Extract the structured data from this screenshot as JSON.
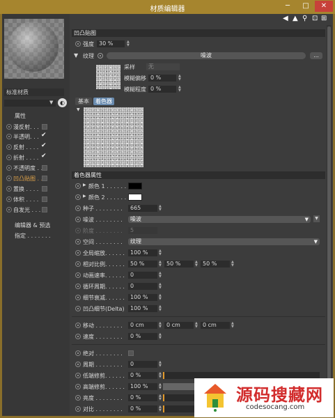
{
  "window": {
    "title": "材质编辑器",
    "min": "─",
    "max": "□",
    "close": "✕"
  },
  "left": {
    "material_name": "标准材质",
    "channels_header": "属性",
    "channels": [
      {
        "label": "漫反射. . .",
        "checked": false
      },
      {
        "label": "半透明. . .",
        "checked": true
      },
      {
        "label": "反射 . . . .",
        "checked": true
      },
      {
        "label": "折射 . . . .",
        "checked": true
      },
      {
        "label": "不透明度 . .",
        "checked": false
      },
      {
        "label": "凹凸贴图 . .",
        "checked": false,
        "active": true
      },
      {
        "label": "置换 . . . .",
        "checked": false
      },
      {
        "label": "体积 . . . .",
        "checked": false
      },
      {
        "label": "自发光 . . .",
        "checked": false
      }
    ],
    "editor_link": "编辑器 & 预选",
    "assign_link": "指定 . . . . . . ."
  },
  "right": {
    "section_bump": "凹凸贴图",
    "strength": {
      "label": "强度",
      "value": "30 %"
    },
    "texture": {
      "label": "纹理",
      "name": "噪波",
      "more": "..."
    },
    "sampling": {
      "label": "采样",
      "value": "无"
    },
    "blur_offset": {
      "label": "模糊偏移",
      "value": "0 %"
    },
    "blur_scale": {
      "label": "模糊程度",
      "value": "0 %"
    },
    "tabs": [
      "基本",
      "着色器"
    ],
    "shader_props": "着色器属性",
    "color1": {
      "label": "颜色 1 . . . . . .",
      "color": "#000000"
    },
    "color2": {
      "label": "颜色 2 . . . . . .",
      "color": "#ffffff"
    },
    "seed": {
      "label": "种子 . . . . . . . .",
      "value": "665"
    },
    "noise": {
      "label": "噪波 . . . . . . . .",
      "value": "噪波"
    },
    "octaves": {
      "label": "阶度 . . . . . . . .",
      "value": "5"
    },
    "space": {
      "label": "空间 . . . . . . . .",
      "value": "纹理"
    },
    "global_scale": {
      "label": "全局缩放. . . . . .",
      "value": "100 %"
    },
    "relative_scale": {
      "label": "相对比例. . . . . .",
      "values": [
        "50 %",
        "50 %",
        "50 %"
      ]
    },
    "anim_speed": {
      "label": "动画速率. . . . . .",
      "value": "0"
    },
    "loop_period": {
      "label": "循环周期. . . . . .",
      "value": "0"
    },
    "detail_atten": {
      "label": "细节衰减. . . . . .",
      "value": "100 %"
    },
    "bump_delta": {
      "label": "凹凸细节(Delta)",
      "value": "100 %"
    },
    "move": {
      "label": "移动 . . . . . . . .",
      "values": [
        "0 cm",
        "0 cm",
        "0 cm"
      ]
    },
    "speed": {
      "label": "速度 . . . . . . . .",
      "value": "0 %"
    },
    "absolute": {
      "label": "绝对 . . . . . . . ."
    },
    "period": {
      "label": "周期 . . . . . . . .",
      "value": "0"
    },
    "low_clip": {
      "label": "低端修剪. . . . . .",
      "value": "0 %",
      "fill": 0.0
    },
    "high_clip": {
      "label": "高端修剪. . . . . .",
      "value": "100 %",
      "fill": 1.0
    },
    "brightness": {
      "label": "亮度 . . . . . . . .",
      "value": "0 %",
      "fill": 0.0
    },
    "contrast": {
      "label": "对比 . . . . . . . .",
      "value": "0 %",
      "fill": 0.0
    }
  },
  "watermark": {
    "text_cn": "源码搜藏网",
    "text_en": "codesocang.com"
  }
}
